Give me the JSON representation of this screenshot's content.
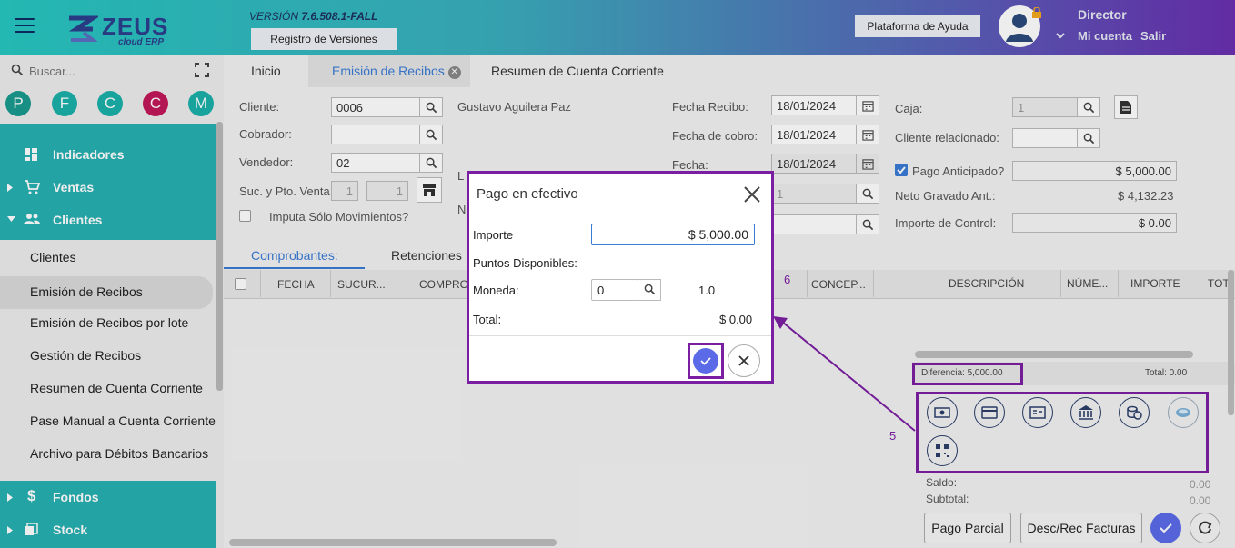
{
  "header": {
    "version_prefix": "VERSIÓN",
    "version_number": "7.6.508.1-FALL",
    "versions_button": "Registro de Versiones",
    "help_button": "Plataforma de Ayuda",
    "logo_text": "ZEUS",
    "logo_sub": "cloud ERP",
    "user_role": "Director",
    "my_account": "Mi cuenta",
    "logout": "Salir"
  },
  "sidebar": {
    "search_placeholder": "Buscar...",
    "quick_buttons": [
      {
        "letter": "P",
        "color": "#1a9a8e"
      },
      {
        "letter": "F",
        "color": "#1ab0a8"
      },
      {
        "letter": "C",
        "color": "#1ab0a8"
      },
      {
        "letter": "C",
        "color": "#c2185b"
      },
      {
        "letter": "M",
        "color": "#1ab0a8"
      }
    ],
    "menu": {
      "indicadores": "Indicadores",
      "ventas": "Ventas",
      "clientes": "Clientes",
      "fondos": "Fondos",
      "stock": "Stock"
    },
    "sub_items": [
      "Clientes",
      "Emisión de Recibos",
      "Emisión de Recibos por lote",
      "Gestión de Recibos",
      "Resumen de Cuenta Corriente",
      "Pase Manual a Cuenta Corriente",
      "Archivo para Débitos Bancarios"
    ]
  },
  "tabs": {
    "inicio": "Inicio",
    "emision": "Emisión de Recibos",
    "resumen": "Resumen de Cuenta Corriente"
  },
  "form": {
    "cliente_label": "Cliente:",
    "cliente_value": "0006",
    "cliente_name": "Gustavo Aguilera Paz",
    "cobrador_label": "Cobrador:",
    "vendedor_label": "Vendedor:",
    "vendedor_value": "02",
    "suc_label": "Suc. y Pto. Venta:",
    "suc_value": "1",
    "pto_value": "1",
    "imputa_label": "Imputa Sólo Movimientos?",
    "fecha_recibo_label": "Fecha Recibo:",
    "fecha_recibo": "18/01/2024",
    "fecha_cobro_label": "Fecha de cobro:",
    "fecha_cobro": "18/01/2024",
    "fecha_label": "Fecha:",
    "fecha": "18/01/2024",
    "hidden_field_value": "1",
    "caja_label": "Caja:",
    "caja_value": "1",
    "cliente_rel_label": "Cliente relacionado:",
    "pago_anticipado_label": "Pago Anticipado?",
    "pago_anticipado_value": "$ 5,000.00",
    "neto_label": "Neto Gravado Ant.:",
    "neto_value": "$ 4,132.23",
    "importe_control_label": "Importe de Control:",
    "importe_control_value": "$ 0.00",
    "partial_l": "L",
    "partial_n": "N"
  },
  "subtabs": {
    "comprobantes": "Comprobantes:",
    "retenciones": "Retenciones"
  },
  "grid": {
    "columns": [
      "FECHA",
      "SUCUR...",
      "COMPRO",
      "CONCEP..."
    ],
    "right_columns": [
      "DESCRIPCIÓN",
      "NÚME...",
      "IMPORTE",
      "TOT"
    ],
    "diferencia": "Diferencia: 5,000.00",
    "total": "Total: 0.00",
    "saldo_label": "Saldo:",
    "saldo_value": "0.00",
    "subtotal_label": "Subtotal:",
    "subtotal_value": "0.00"
  },
  "annotations": {
    "step5": "5",
    "step6": "6"
  },
  "footer": {
    "pago_parcial": "Pago Parcial",
    "desc_rec": "Desc/Rec Facturas"
  },
  "modal": {
    "title": "Pago en efectivo",
    "importe_label": "Importe",
    "importe_value": "$ 5,000.00",
    "puntos_label": "Puntos Disponibles:",
    "moneda_label": "Moneda:",
    "moneda_value": "0",
    "moneda_rate": "1.0",
    "total_label": "Total:",
    "total_value": "$ 0.00"
  },
  "colors": {
    "accent": "#3a7bd5",
    "sidebar_teal": "#27b0b1",
    "highlight": "#7b1fa2",
    "confirm": "#5b6be8"
  }
}
